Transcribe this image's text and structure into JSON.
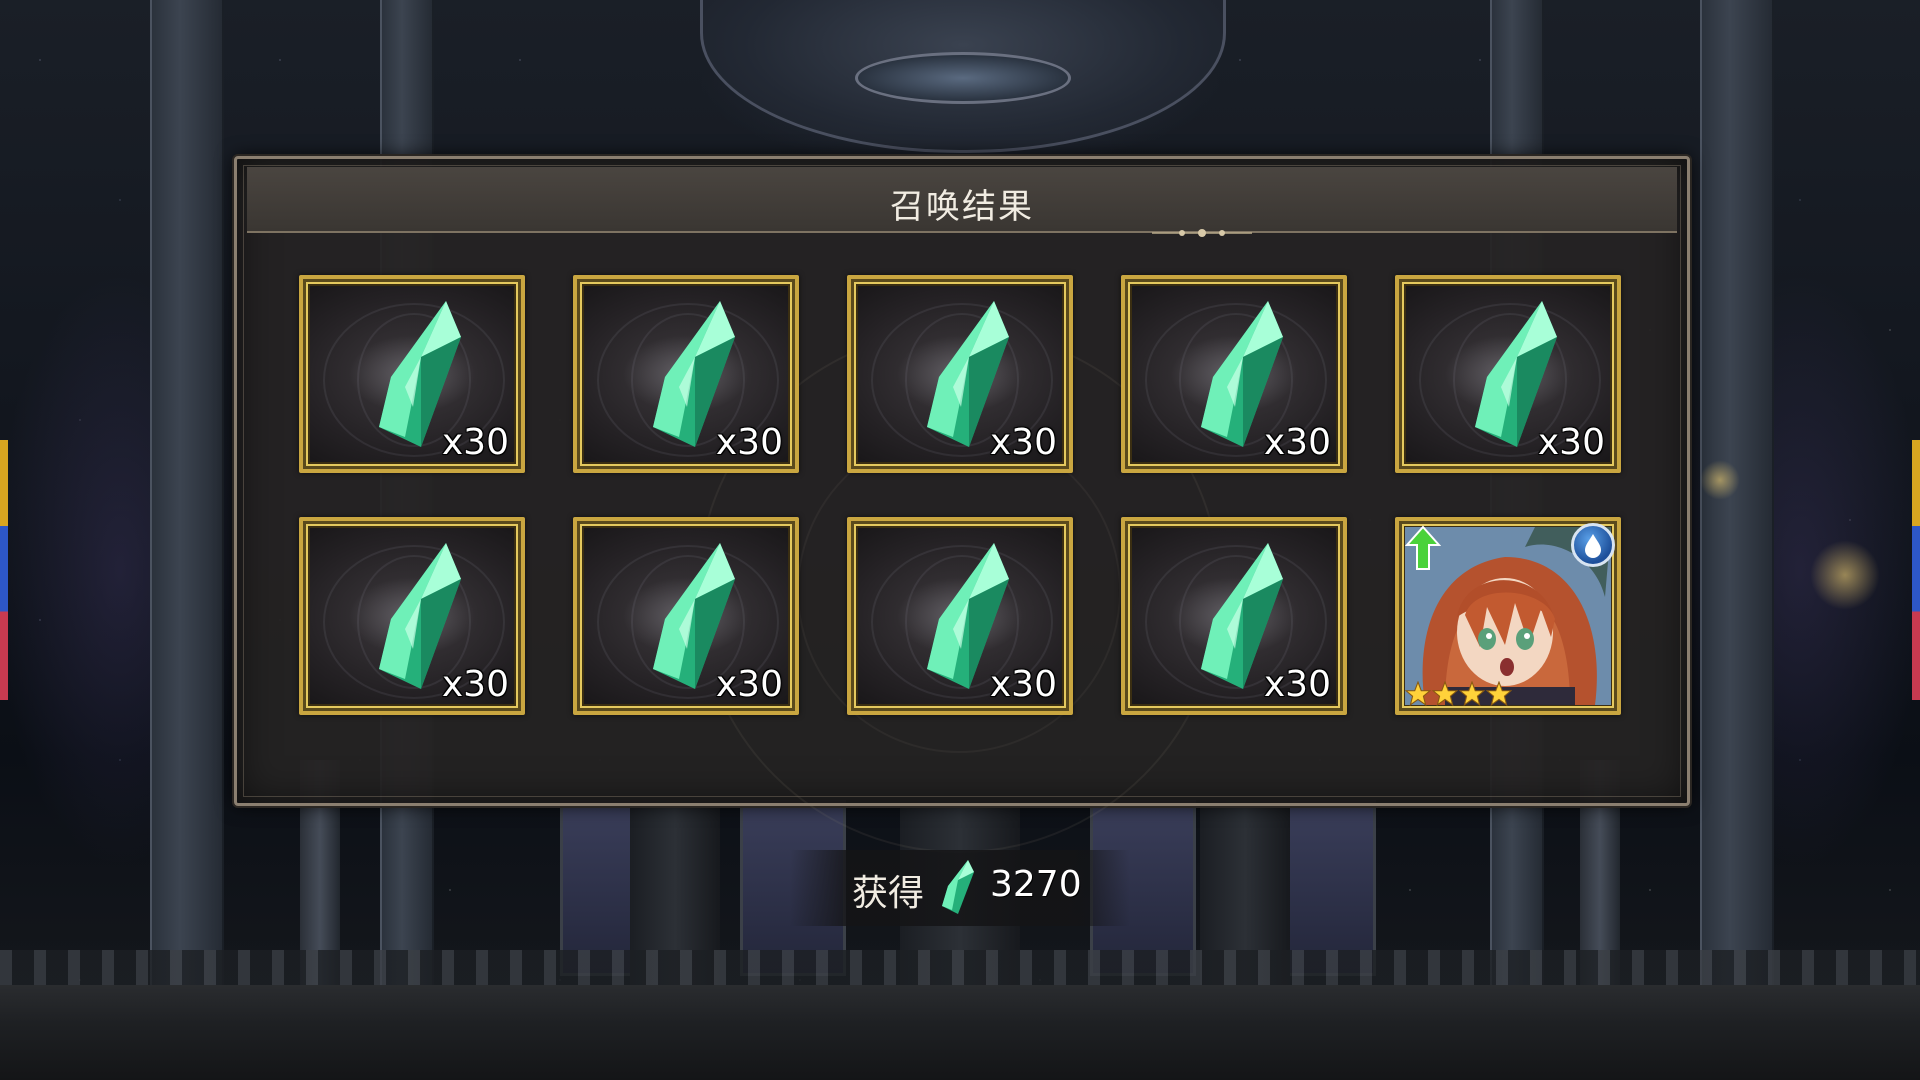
{
  "dialog": {
    "title": "召唤结果"
  },
  "results": [
    {
      "type": "crystal",
      "quantity": "x30"
    },
    {
      "type": "crystal",
      "quantity": "x30"
    },
    {
      "type": "crystal",
      "quantity": "x30"
    },
    {
      "type": "crystal",
      "quantity": "x30"
    },
    {
      "type": "crystal",
      "quantity": "x30"
    },
    {
      "type": "crystal",
      "quantity": "x30"
    },
    {
      "type": "crystal",
      "quantity": "x30"
    },
    {
      "type": "crystal",
      "quantity": "x30"
    },
    {
      "type": "crystal",
      "quantity": "x30"
    },
    {
      "type": "character",
      "rarity_stars": 4,
      "element": "water-icon",
      "has_upgrade_arrow": true
    }
  ],
  "obtained": {
    "label": "获得",
    "icon": "green-crystal-icon",
    "value": "3270"
  },
  "colors": {
    "card_gold": "#c9a640",
    "crystal_green": "#3ad69a",
    "panel_bg": "#262424",
    "panel_border": "#8b7f70",
    "title_text": "#f1ece2"
  }
}
